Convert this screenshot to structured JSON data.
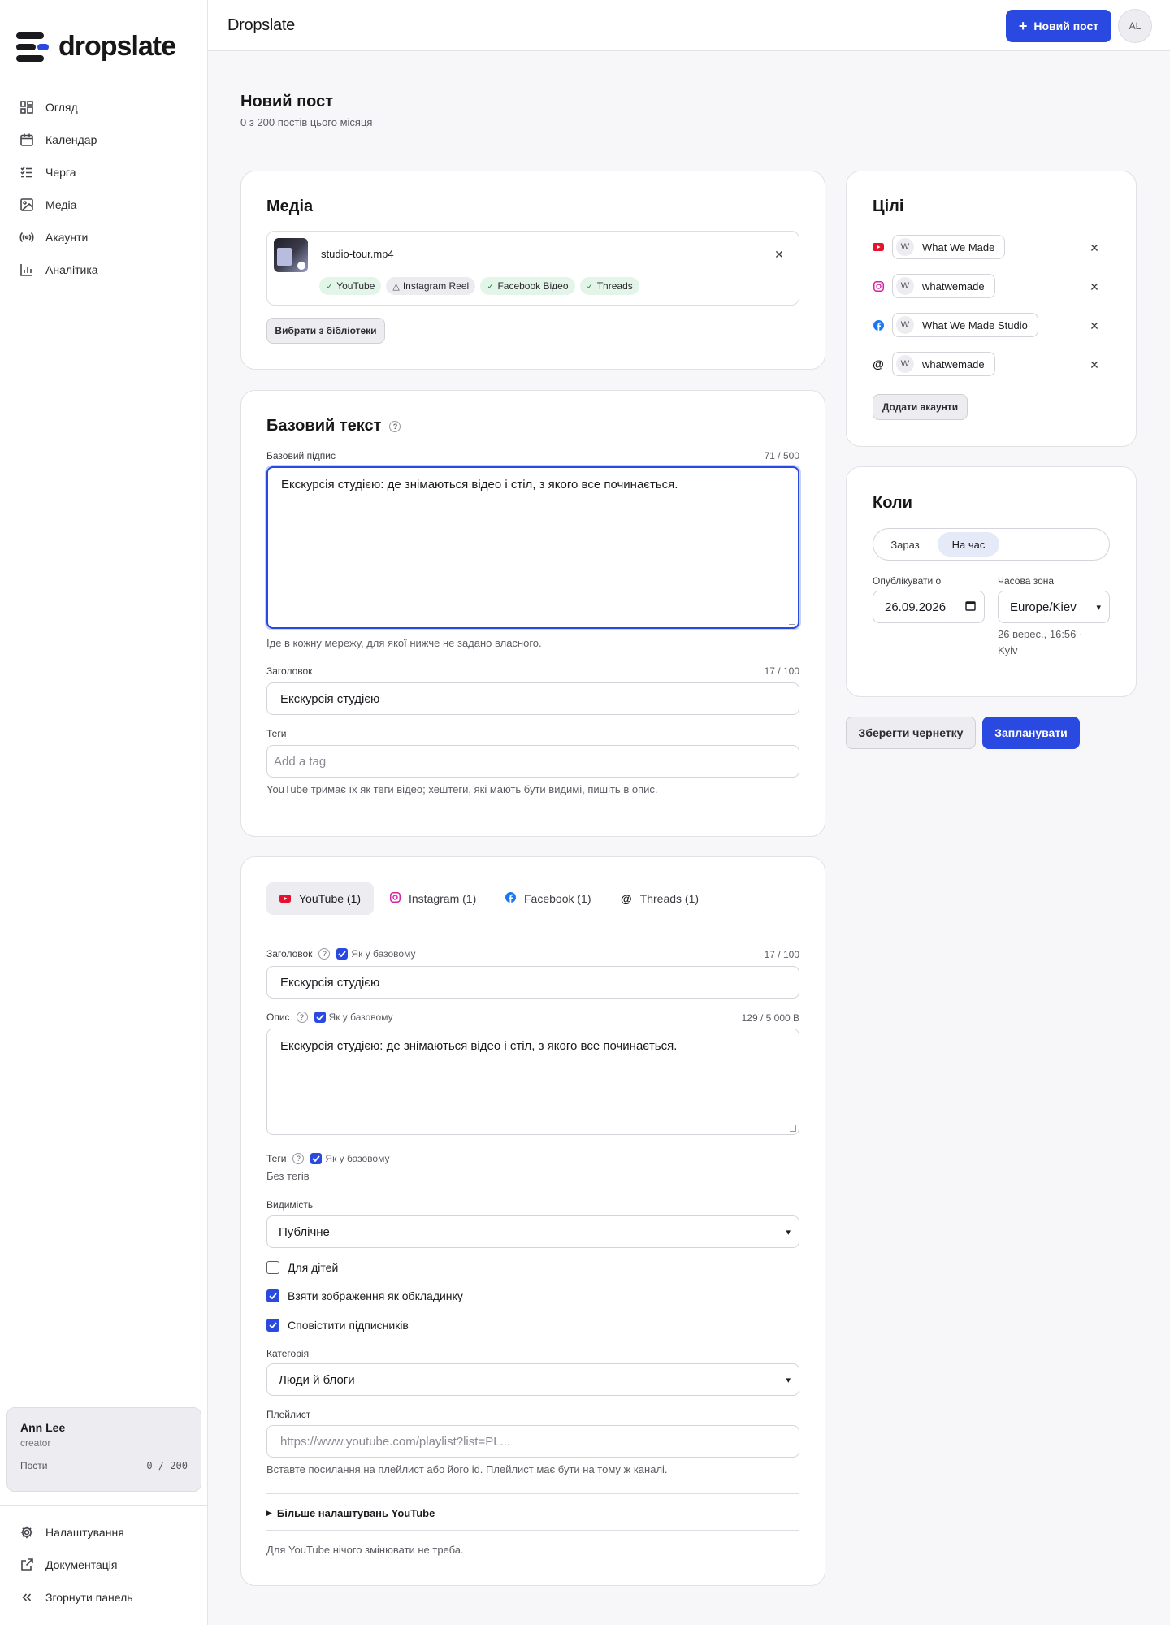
{
  "app": {
    "logo_text": "dropslate",
    "title": "Dropslate",
    "new_post_button": "Новий пост",
    "avatar_initials": "AL"
  },
  "sidebar": {
    "items": [
      {
        "label": "Огляд",
        "icon": "grid-icon"
      },
      {
        "label": "Календар",
        "icon": "calendar-icon"
      },
      {
        "label": "Черга",
        "icon": "queue-icon"
      },
      {
        "label": "Медіа",
        "icon": "image-icon"
      },
      {
        "label": "Акаунти",
        "icon": "broadcast-icon"
      },
      {
        "label": "Аналітика",
        "icon": "bar-chart-icon"
      }
    ],
    "bottom_items": [
      {
        "label": "Налаштування",
        "icon": "gear-icon"
      },
      {
        "label": "Документація",
        "icon": "external-link-icon"
      },
      {
        "label": "Згорнути панель",
        "icon": "chevrons-left-icon"
      }
    ],
    "user": {
      "name": "Ann Lee",
      "role": "creator",
      "posts_label": "Пости",
      "posts_value": "0 / 200"
    }
  },
  "page": {
    "title": "Новий пост",
    "subtitle": "0 з 200 постів цього місяця"
  },
  "media": {
    "title": "Медіа",
    "file_name": "studio-tour.mp4",
    "chips": [
      {
        "label": "YouTube",
        "status": "ok"
      },
      {
        "label": "Instagram Reel",
        "status": "warn"
      },
      {
        "label": "Facebook Відео",
        "status": "ok"
      },
      {
        "label": "Threads",
        "status": "ok"
      }
    ],
    "library_button": "Вибрати з бібліотеки"
  },
  "base_text": {
    "title": "Базовий текст",
    "caption_label": "Базовий підпис",
    "caption_counter": "71 / 500",
    "caption_value": "Екскурсія студією: де знімаються відео і стіл, з якого все починається.",
    "caption_hint": "Іде в кожну мережу, для якої нижче не задано власного.",
    "headline_label": "Заголовок",
    "headline_counter": "17 / 100",
    "headline_value": "Екскурсія студією",
    "tags_label": "Теги",
    "tags_placeholder": "Add a tag",
    "tags_hint": "YouTube тримає їх як теги відео; хештеги, які мають бути видимі, пишіть в опис."
  },
  "targets": {
    "title": "Цілі",
    "accounts": [
      {
        "network": "youtube",
        "initial": "W",
        "name": "What We Made",
        "color": "#e8112d"
      },
      {
        "network": "instagram",
        "initial": "W",
        "name": "whatwemade",
        "color": "#d6249f"
      },
      {
        "network": "facebook",
        "initial": "W",
        "name": "What We Made Studio",
        "color": "#1877f2"
      },
      {
        "network": "threads",
        "initial": "W",
        "name": "whatwemade",
        "color": "#111111"
      }
    ],
    "add_button": "Додати акаунти"
  },
  "when": {
    "title": "Коли",
    "options": [
      "Зараз",
      "На час"
    ],
    "selected": "На час",
    "publish_label": "Опублікувати о",
    "publish_value": "26.09.2026",
    "tz_label": "Часова зона",
    "tz_value": "Europe/Kiev",
    "tz_hint": "26 верес., 16:56 · Kyiv"
  },
  "actions": {
    "save_draft": "Зберегти чернетку",
    "schedule": "Запланувати"
  },
  "tabs": [
    {
      "label": "YouTube (1)",
      "icon": "youtube-icon",
      "color": "#e8112d"
    },
    {
      "label": "Instagram (1)",
      "icon": "instagram-icon",
      "color": "#d6249f"
    },
    {
      "label": "Facebook (1)",
      "icon": "facebook-icon",
      "color": "#1877f2"
    },
    {
      "label": "Threads (1)",
      "icon": "threads-icon",
      "color": "#111111"
    }
  ],
  "youtube": {
    "headline_label": "Заголовок",
    "same_as_base": "Як у базовому",
    "headline_counter": "17 / 100",
    "headline_value": "Екскурсія студією",
    "desc_label": "Опис",
    "desc_counter": "129 / 5 000 B",
    "desc_value": "Екскурсія студією: де знімаються відео і стіл, з якого все починається.",
    "tags_label": "Теги",
    "tags_empty": "Без тегів",
    "visibility_label": "Видимість",
    "visibility_value": "Публічне",
    "checkboxes": [
      {
        "label": "Для дітей",
        "checked": false
      },
      {
        "label": "Взяти зображення як обкладинку",
        "checked": true
      },
      {
        "label": "Сповістити підписників",
        "checked": true
      }
    ],
    "category_label": "Категорія",
    "category_value": "Люди й блоги",
    "playlist_label": "Плейлист",
    "playlist_placeholder": "https://www.youtube.com/playlist?list=PL...",
    "playlist_hint": "Вставте посилання на плейлист або його id. Плейлист має бути на тому ж каналі.",
    "more_settings": "Більше налаштувань YouTube",
    "footer_note": "Для YouTube нічого змінювати не треба."
  },
  "colors": {
    "accent": "#2a49e0",
    "ok_chip": "#e3f4e8"
  }
}
